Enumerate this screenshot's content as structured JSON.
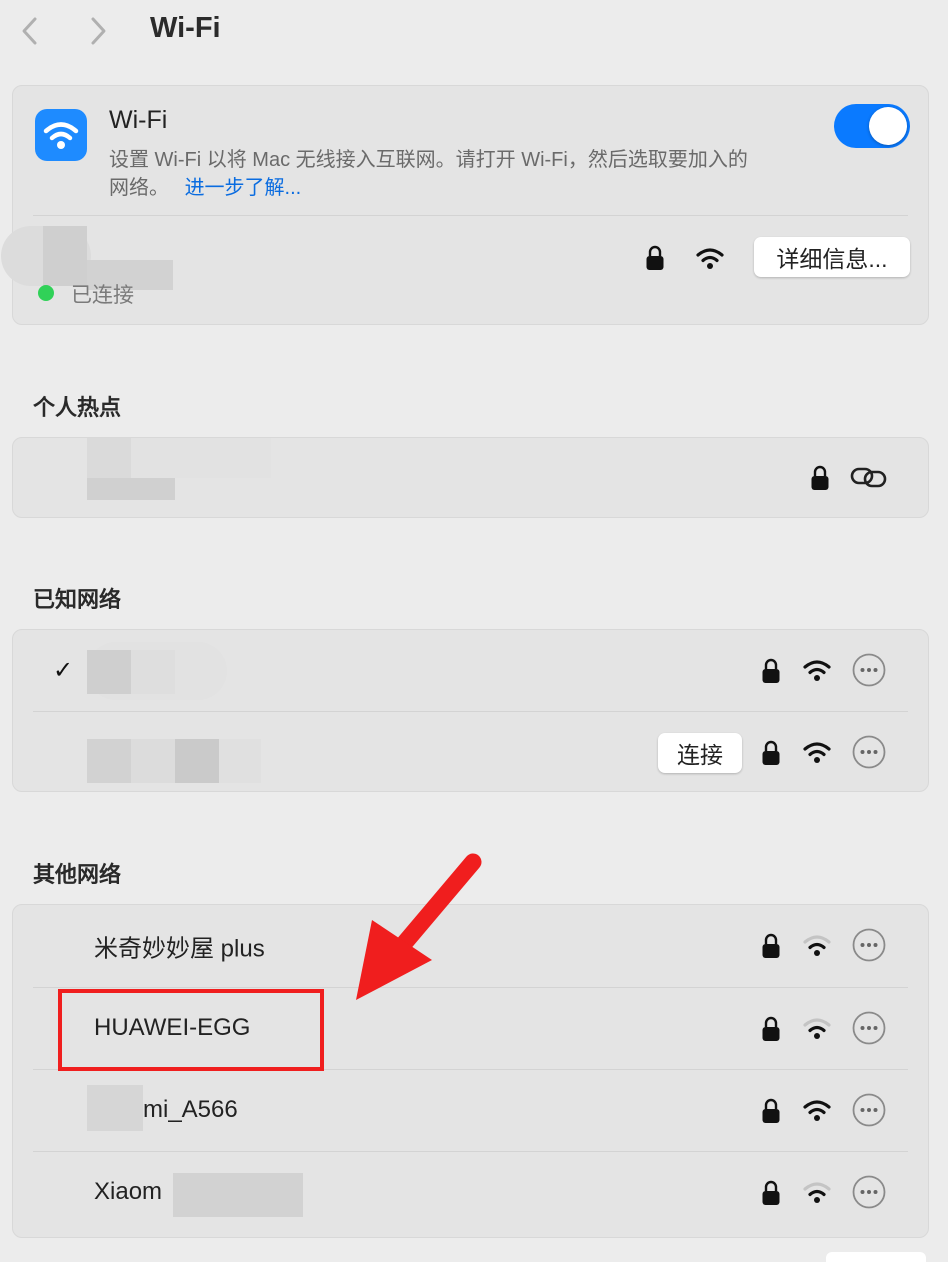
{
  "header": {
    "title": "Wi-Fi"
  },
  "wifi_card": {
    "title": "Wi-Fi",
    "description": "设置 Wi-Fi 以将 Mac 无线接入互联网。请打开 Wi-Fi，然后选取要加入的",
    "description_line2": "网络。",
    "learn_more": "进一步了解...",
    "toggle_on": true,
    "status": "已连接",
    "details_button": "详细信息..."
  },
  "hotspot": {
    "title": "个人热点"
  },
  "known": {
    "title": "已知网络",
    "connect_button": "连接"
  },
  "other": {
    "title": "其他网络",
    "networks": [
      {
        "name": "米奇妙妙屋 plus",
        "signal": "weak"
      },
      {
        "name": "HUAWEI-EGG",
        "signal": "weak"
      },
      {
        "name": "mi_A566",
        "signal": "strong"
      },
      {
        "name": "Xiaom",
        "signal": "weak"
      }
    ]
  },
  "colors": {
    "accent": "#0a7aff",
    "annotation": "#f01e1e",
    "status_green": "#30d158"
  }
}
